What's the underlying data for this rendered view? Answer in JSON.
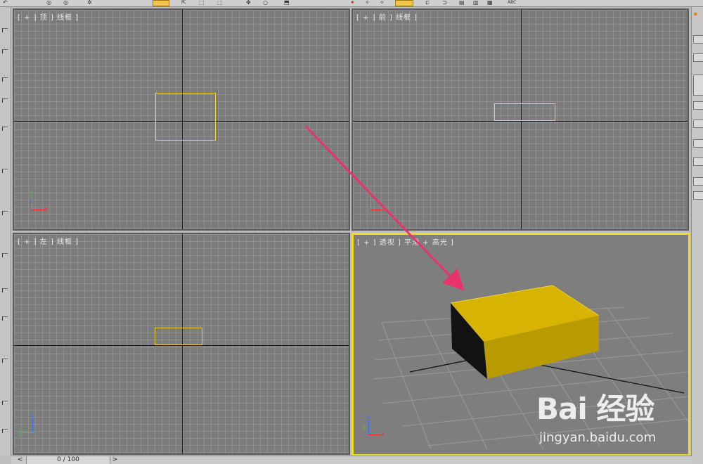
{
  "toolbar": {
    "abc_label": "ABC"
  },
  "viewports": {
    "top": {
      "label": "[ + ] 顶 ] 线框 ]"
    },
    "front": {
      "label": "[ + ] 前 ] 线框 ]"
    },
    "left": {
      "label": "[ + ] 左 ] 线框 ]"
    },
    "perspective": {
      "label": "[ + ] 透视 ] 平滑 + 高光 ]"
    }
  },
  "gizmo": {
    "x": "x",
    "y": "y",
    "z": "z"
  },
  "timeline": {
    "prev": "<",
    "counter": "0 / 100",
    "next": ">"
  },
  "watermark": {
    "logo": "Bai 经验",
    "url": "jingyan.baidu.com"
  },
  "colors": {
    "selection": "#f3d33a",
    "active_border": "#f0dd22",
    "box_top": "#d7b402",
    "box_front": "#b99a00",
    "box_side": "#121212",
    "arrow": "#e8336b"
  }
}
